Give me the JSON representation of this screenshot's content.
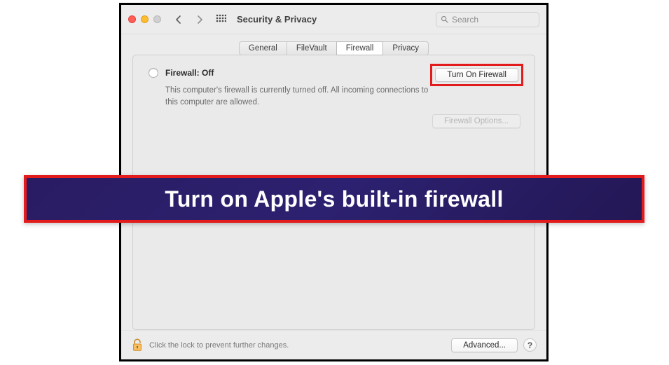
{
  "window": {
    "title": "Security & Privacy"
  },
  "search": {
    "placeholder": "Search"
  },
  "tabs": [
    {
      "label": "General"
    },
    {
      "label": "FileVault"
    },
    {
      "label": "Firewall",
      "active": true
    },
    {
      "label": "Privacy"
    }
  ],
  "firewall": {
    "status_label": "Firewall: Off",
    "description": "This computer's firewall is currently turned off. All incoming connections to this computer are allowed.",
    "turn_on_label": "Turn On Firewall",
    "options_label": "Firewall Options..."
  },
  "footer": {
    "lock_text": "Click the lock to prevent further changes.",
    "advanced_label": "Advanced...",
    "help_label": "?"
  },
  "overlay": {
    "text": "Turn on Apple's built-in firewall"
  },
  "colors": {
    "highlight": "#e21c1c",
    "banner_bg": "#2a1c63"
  }
}
